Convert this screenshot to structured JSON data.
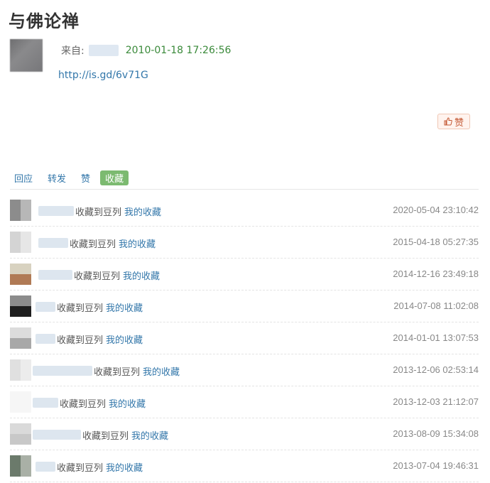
{
  "post": {
    "title": "与佛论禅",
    "from_label": "来自:",
    "time": "2010-01-18 17:26:56",
    "link": "http://is.gd/6v71G"
  },
  "like_button": {
    "label": "赞",
    "icon": "thumbs-up-icon"
  },
  "tabs": [
    {
      "label": "回应",
      "active": false
    },
    {
      "label": "转发",
      "active": false
    },
    {
      "label": "赞",
      "active": false
    },
    {
      "label": "收藏",
      "active": true
    }
  ],
  "rows": [
    {
      "action": "收藏到豆列",
      "collection": "我的收藏",
      "time": "2020-05-04 23:10:42"
    },
    {
      "action": "收藏到豆列",
      "collection": "我的收藏",
      "time": "2015-04-18 05:27:35"
    },
    {
      "action": "收藏到豆列",
      "collection": "我的收藏",
      "time": "2014-12-16 23:49:18"
    },
    {
      "action": "收藏到豆列",
      "collection": "我的收藏",
      "time": "2014-07-08 11:02:08"
    },
    {
      "action": "收藏到豆列",
      "collection": "我的收藏",
      "time": "2014-01-01 13:07:53"
    },
    {
      "action": "收藏到豆列",
      "collection": "我的收藏",
      "time": "2013-12-06 02:53:14"
    },
    {
      "action": "收藏到豆列",
      "collection": "我的收藏",
      "time": "2013-12-03 21:12:07"
    },
    {
      "action": "收藏到豆列",
      "collection": "我的收藏",
      "time": "2013-08-09 15:34:08"
    },
    {
      "action": "收藏到豆列",
      "collection": "我的收藏",
      "time": "2013-07-04 19:46:31"
    }
  ],
  "colors": {
    "link": "#3377aa",
    "time_green": "#3a8a3a",
    "active_tab": "#7cba70",
    "like_text": "#c45a36"
  }
}
